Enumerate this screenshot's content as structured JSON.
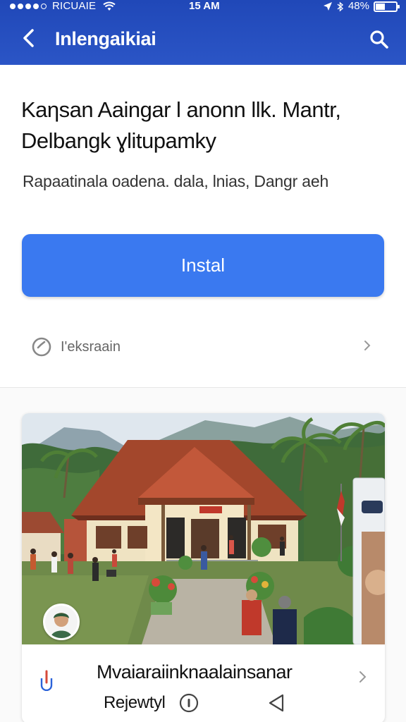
{
  "status_bar": {
    "carrier": "RICUAIE",
    "time": "15 AM",
    "battery": "48%",
    "battery_level": 0.48
  },
  "app_bar": {
    "title": "Inlengaikiai",
    "back_icon": "chevron-left-icon",
    "search_icon": "search-icon"
  },
  "header": {
    "title_line1": "Kaηsan Aaingar l anonn llk. Mantr,",
    "title_line2": "Delbangk ɣlitupamky",
    "subtitle": "Rapaatinala oadena. dala, lnias, Dangr aeh",
    "install_label": "Instal"
  },
  "info_row": {
    "label": "I'eksraain",
    "icon": "check-circle-icon",
    "chevron_icon": "chevron-right-icon"
  },
  "card": {
    "image_description_icon": "photo-icon",
    "footer_title": "Mvaiaraiinknaalainsanar",
    "footer_sub": "Rejewtyl",
    "footer_icon": "share-icon",
    "chevron_icon": "chevron-right-icon"
  },
  "colors": {
    "app_bar": "#2b55c6",
    "install_button": "#3a79f0",
    "text": "#111111"
  }
}
